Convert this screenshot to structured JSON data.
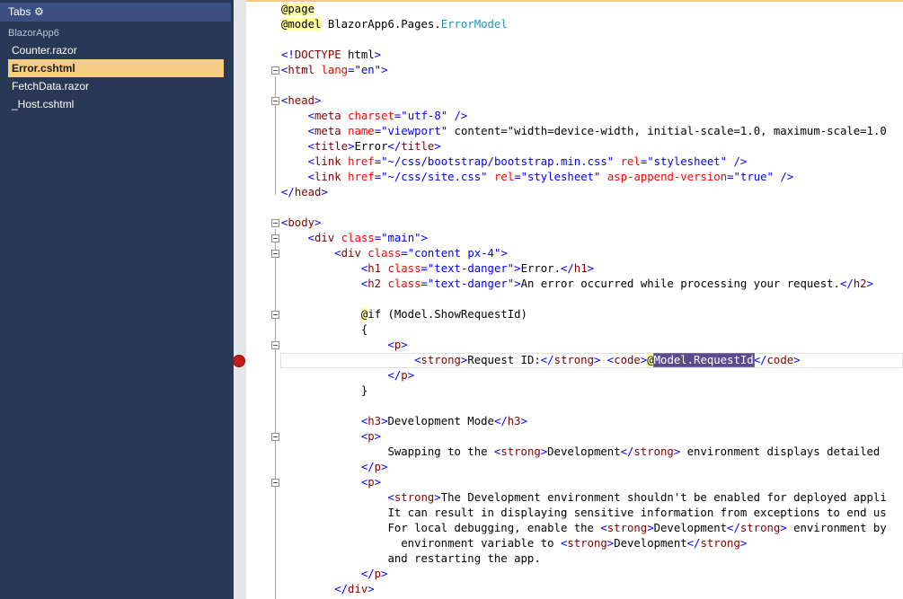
{
  "sidebar": {
    "header_label": "Tabs",
    "project": "BlazorApp6",
    "files": [
      {
        "label": "Counter.razor",
        "selected": false
      },
      {
        "label": "Error.cshtml",
        "selected": true
      },
      {
        "label": "FetchData.razor",
        "selected": false
      },
      {
        "label": "_Host.cshtml",
        "selected": false
      }
    ]
  },
  "editor": {
    "lines": [
      "@page",
      "@model BlazorApp6.Pages.ErrorModel",
      "",
      "<!DOCTYPE html>",
      "<html lang=\"en\">",
      "",
      "<head>",
      "    <meta charset=\"utf-8\" />",
      "    <meta name=\"viewport\" content=\"width=device-width, initial-scale=1.0, maximum-scale=1.0",
      "    <title>Error</title>",
      "    <link href=\"~/css/bootstrap/bootstrap.min.css\" rel=\"stylesheet\" />",
      "    <link href=\"~/css/site.css\" rel=\"stylesheet\" asp-append-version=\"true\" />",
      "</head>",
      "",
      "<body>",
      "    <div class=\"main\">",
      "        <div class=\"content px-4\">",
      "            <h1 class=\"text-danger\">Error.</h1>",
      "            <h2 class=\"text-danger\">An error occurred while processing your request.</h2>",
      "",
      "            @if (Model.ShowRequestId)",
      "            {",
      "                <p>",
      "                    <strong>Request ID:</strong> <code>@Model.RequestId</code>",
      "                </p>",
      "            }",
      "",
      "            <h3>Development Mode</h3>",
      "            <p>",
      "                Swapping to the <strong>Development</strong> environment displays detailed",
      "            </p>",
      "            <p>",
      "                <strong>The Development environment shouldn't be enabled for deployed appli",
      "                It can result in displaying sensitive information from exceptions to end us",
      "                For local debugging, enable the <strong>Development</strong> environment by",
      "                  environment variable to <strong>Development</strong>",
      "                and restarting the app.",
      "            </p>",
      "        </div>"
    ],
    "breakpoint_line": 24
  },
  "colors": {
    "sidebar_bg": "#293955",
    "selected_tab": "#f5cc84",
    "tag": "#800000",
    "attribute": "#ff0000",
    "string": "#0000ff",
    "type": "#2b91af",
    "breakpoint": "#c31c1c"
  },
  "icons": {
    "tabs_settings": "gear-icon",
    "breakpoint": "breakpoint-icon",
    "fold": "collapse-icon"
  }
}
